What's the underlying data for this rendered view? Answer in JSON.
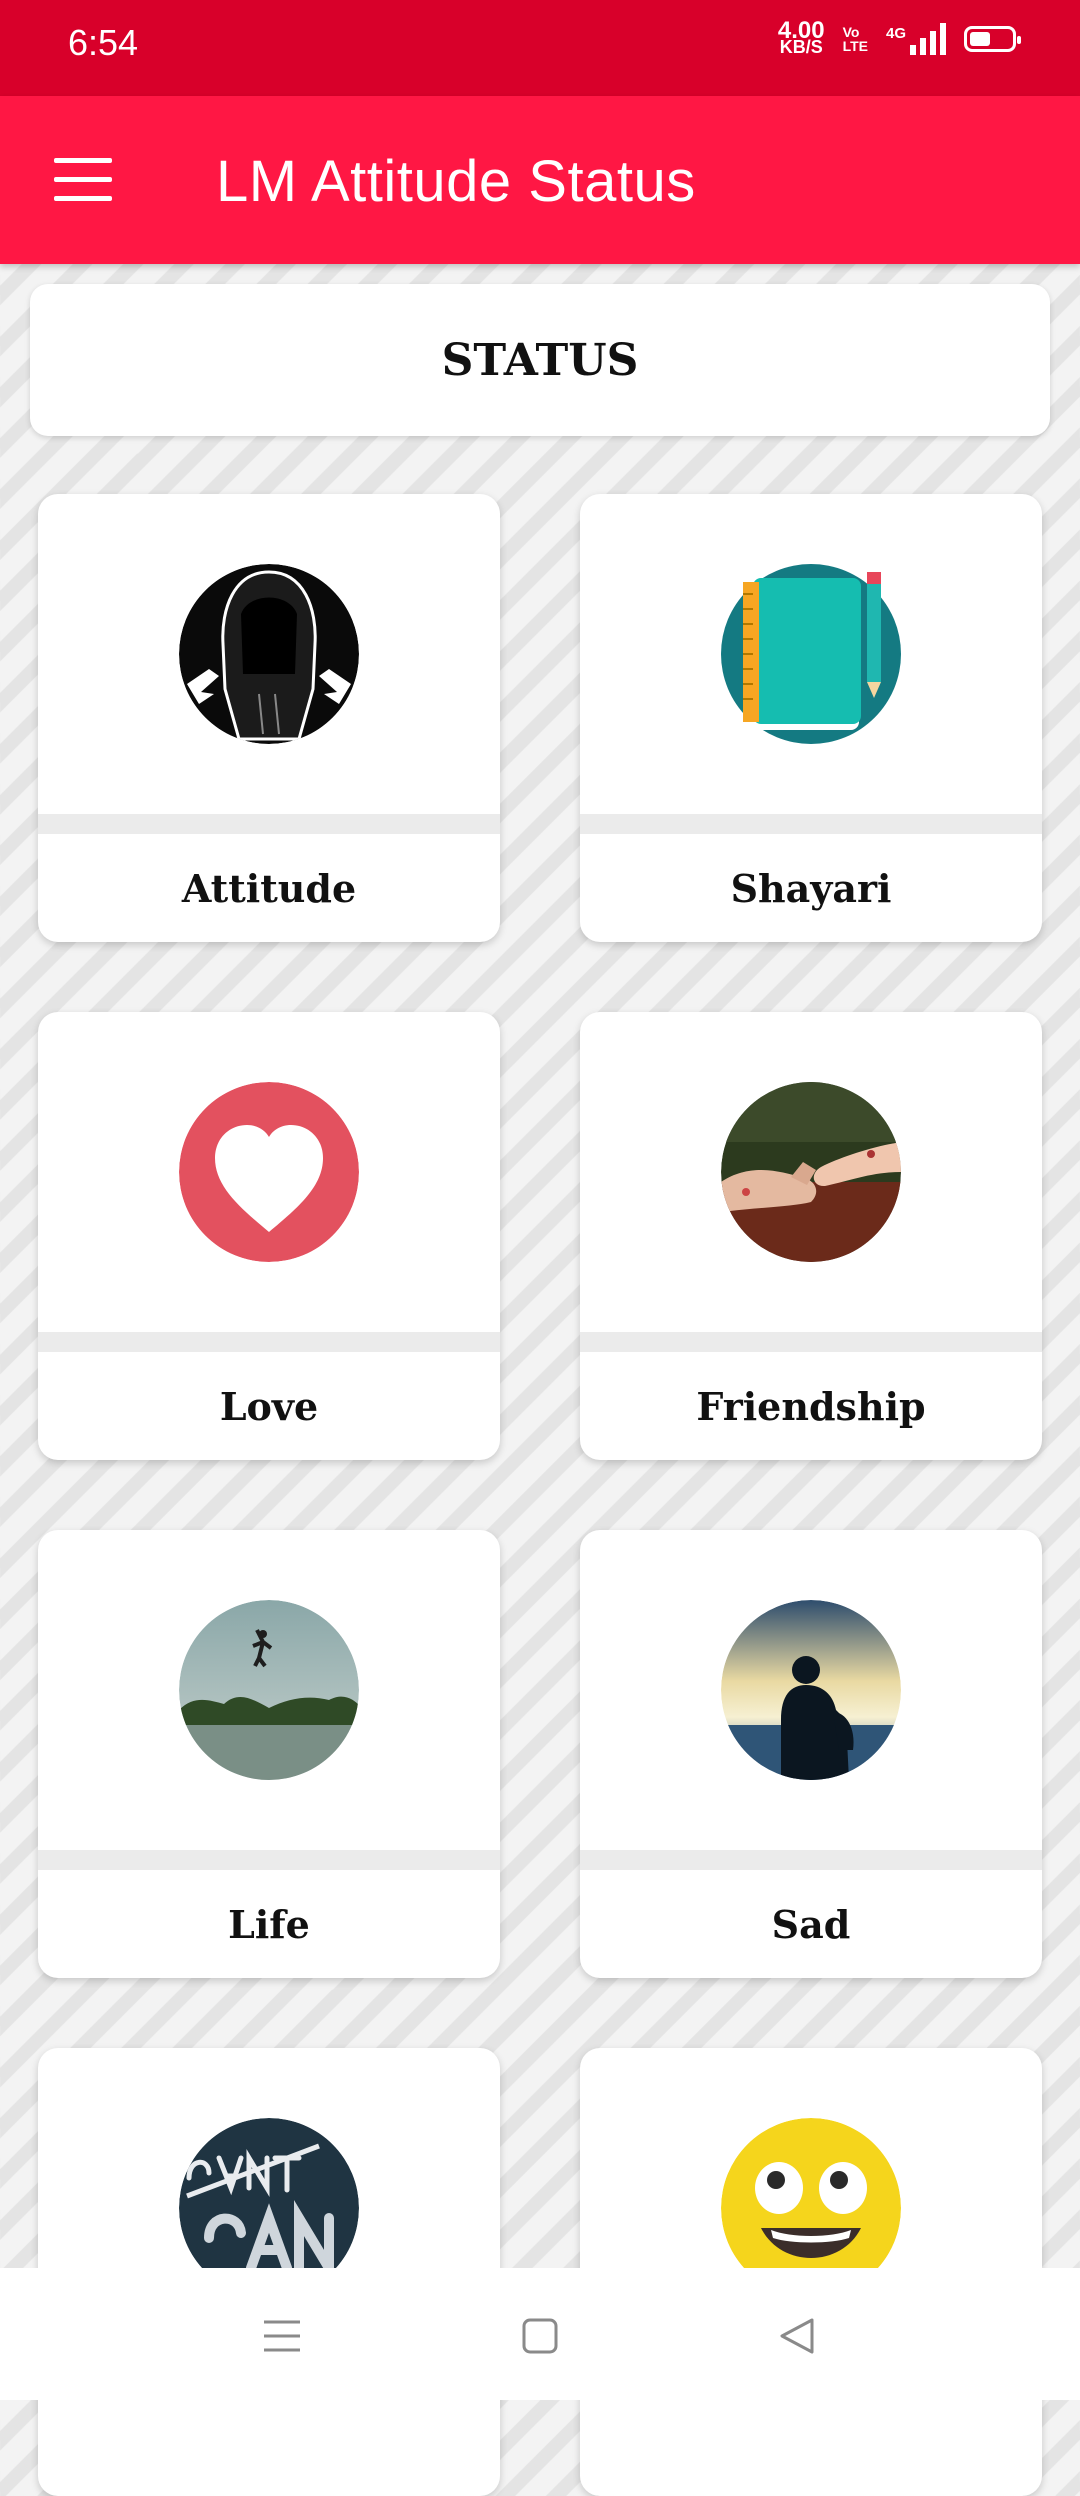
{
  "status_bar": {
    "time": "6:54",
    "net_speed_value": "4.00",
    "net_speed_unit": "KB/S",
    "volte_top": "Vo",
    "volte_bottom": "LTE",
    "network_type": "4G"
  },
  "app_bar": {
    "title": "LM Attitude Status"
  },
  "section": {
    "title": "STATUS"
  },
  "categories": [
    {
      "label": "Attitude",
      "icon": "hooded-figure-icon"
    },
    {
      "label": "Shayari",
      "icon": "notebook-pencil-icon"
    },
    {
      "label": "Love",
      "icon": "heart-icon"
    },
    {
      "label": "Friendship",
      "icon": "pinky-promise-photo"
    },
    {
      "label": "Life",
      "icon": "lake-jump-photo"
    },
    {
      "label": "Sad",
      "icon": "sad-silhouette-photo"
    },
    {
      "label": "",
      "icon": "cant-can-icon"
    },
    {
      "label": "",
      "icon": "smiley-emoji-icon"
    }
  ],
  "colors": {
    "status_bar": "#d8002a",
    "app_bar": "#ff1744",
    "love_heart_bg": "#e3515f",
    "shayari_bg": "#147a82",
    "smiley": "#f5d51c"
  }
}
